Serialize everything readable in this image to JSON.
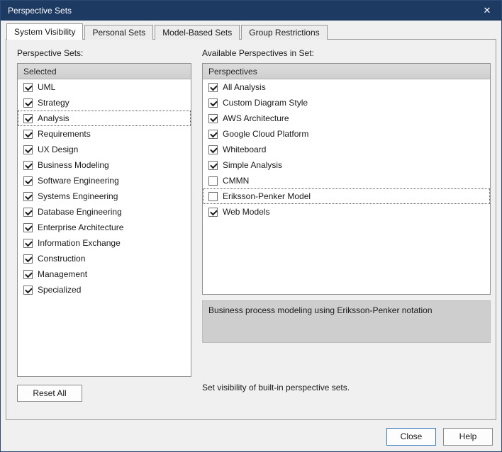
{
  "window": {
    "title": "Perspective Sets",
    "close_icon": "✕"
  },
  "colors": {
    "titlebar": "#1d3a63",
    "default_button_border": "#3a7bbf",
    "list_header_bg": "#d4d4d4",
    "description_bg": "#cecece"
  },
  "tabs": [
    {
      "label": "System Visibility",
      "active": true
    },
    {
      "label": "Personal Sets",
      "active": false
    },
    {
      "label": "Model-Based Sets",
      "active": false
    },
    {
      "label": "Group Restrictions",
      "active": false
    }
  ],
  "left_panel": {
    "label": "Perspective Sets:",
    "header": "Selected",
    "items": [
      {
        "label": "UML",
        "checked": true,
        "focused": false
      },
      {
        "label": "Strategy",
        "checked": true,
        "focused": false
      },
      {
        "label": "Analysis",
        "checked": true,
        "focused": true
      },
      {
        "label": "Requirements",
        "checked": true,
        "focused": false
      },
      {
        "label": "UX Design",
        "checked": true,
        "focused": false
      },
      {
        "label": "Business Modeling",
        "checked": true,
        "focused": false
      },
      {
        "label": "Software Engineering",
        "checked": true,
        "focused": false
      },
      {
        "label": "Systems Engineering",
        "checked": true,
        "focused": false
      },
      {
        "label": "Database Engineering",
        "checked": true,
        "focused": false
      },
      {
        "label": "Enterprise Architecture",
        "checked": true,
        "focused": false
      },
      {
        "label": "Information Exchange",
        "checked": true,
        "focused": false
      },
      {
        "label": "Construction",
        "checked": true,
        "focused": false
      },
      {
        "label": "Management",
        "checked": true,
        "focused": false
      },
      {
        "label": "Specialized",
        "checked": true,
        "focused": false
      }
    ],
    "reset_button": "Reset All"
  },
  "right_panel": {
    "label": "Available Perspectives in Set:",
    "header": "Perspectives",
    "items": [
      {
        "label": "All Analysis",
        "checked": true,
        "focused": false
      },
      {
        "label": "Custom Diagram Style",
        "checked": true,
        "focused": false
      },
      {
        "label": "AWS Architecture",
        "checked": true,
        "focused": false
      },
      {
        "label": "Google Cloud Platform",
        "checked": true,
        "focused": false
      },
      {
        "label": "Whiteboard",
        "checked": true,
        "focused": false
      },
      {
        "label": "Simple Analysis",
        "checked": true,
        "focused": false
      },
      {
        "label": "CMMN",
        "checked": false,
        "focused": false
      },
      {
        "label": "Eriksson-Penker Model",
        "checked": false,
        "focused": true
      },
      {
        "label": "Web Models",
        "checked": true,
        "focused": false
      }
    ],
    "description": "Business process modeling using Eriksson-Penker notation"
  },
  "footer": {
    "status_text": "Set visibility of built-in perspective sets.",
    "close_button": "Close",
    "help_button": "Help"
  }
}
